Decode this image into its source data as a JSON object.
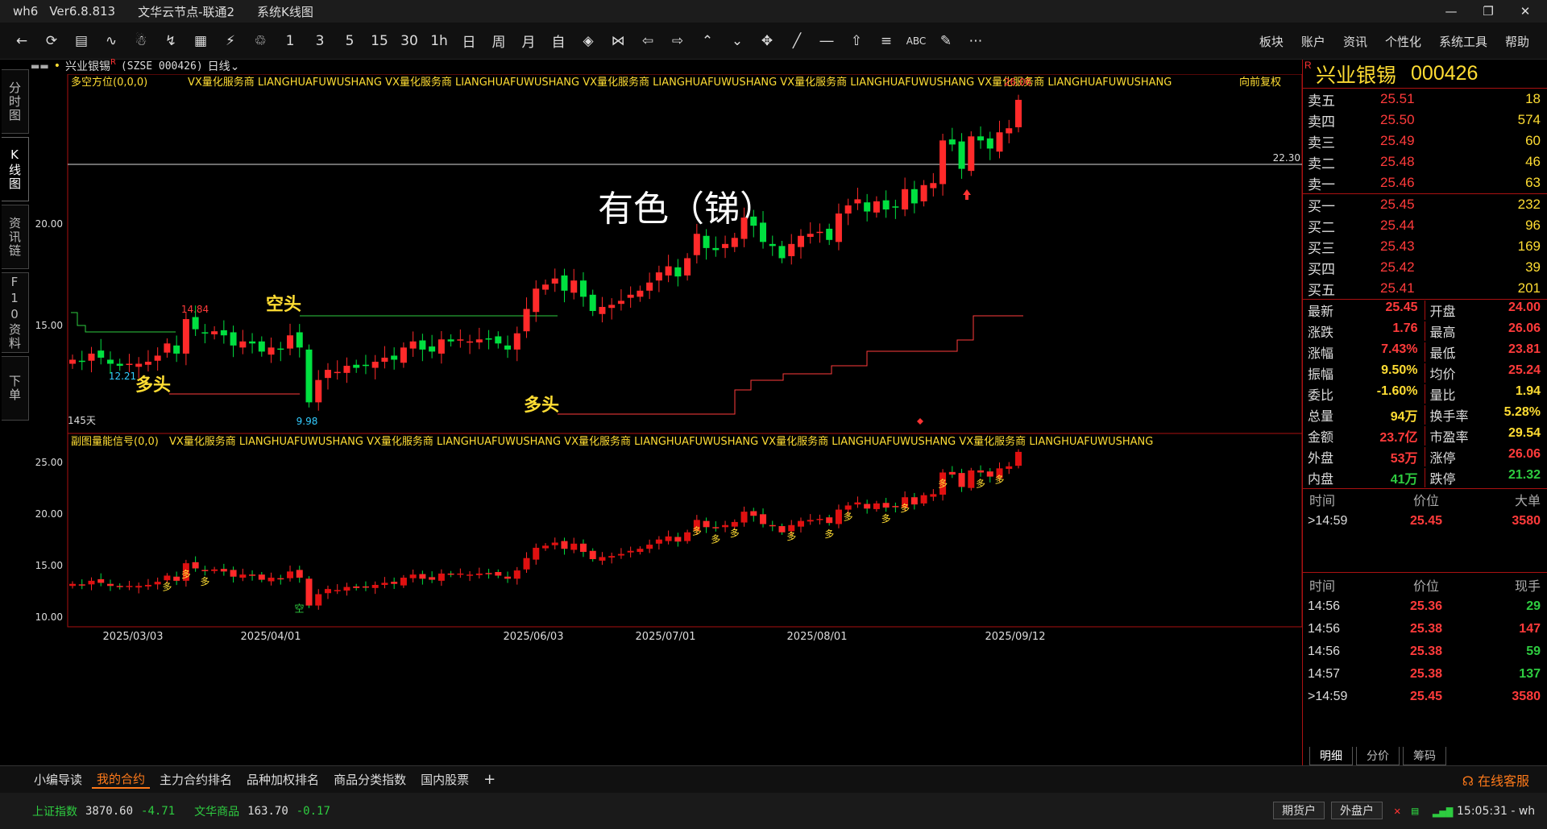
{
  "titlebar": {
    "app": "wh6",
    "version": "Ver6.8.813",
    "node": "文华云节点-联通2",
    "view": "系统K线图"
  },
  "toolbar": {
    "period_labels": [
      "1",
      "3",
      "5",
      "15",
      "30",
      "1h",
      "日",
      "周",
      "月",
      "自"
    ],
    "abc_label": "ABC",
    "menu": [
      "板块",
      "账户",
      "资讯",
      "个性化",
      "系统工具",
      "帮助"
    ]
  },
  "lefttabs": [
    "分时图",
    "K线图",
    "资讯链",
    "F10资料",
    "下单"
  ],
  "chartinfo": {
    "name": "兴业银锡",
    "sup": "R",
    "code": "(SZSE 000426)",
    "period": "日线"
  },
  "main_chart": {
    "indicator": "多空方位(0,0,0)",
    "ads": "VX量化服务商  LIANGHUAFUWUSHANG  VX量化服务商  LIANGHUAFUWUSHANG  VX量化服务商  LIANGHUAFUWUSHANG  VX量化服务商  LIANGHUAFUWUSHANG  VX量化服务商  LIANGHUAFUWUSHANG",
    "fq_label": "向前复权",
    "yticks": [
      "20.00",
      "15.00"
    ],
    "hline_label": "22.30",
    "high_label": "26.06",
    "label_1484": "14.84",
    "label_1221": "12.21",
    "label_998": "9.98",
    "days_label": "145天",
    "big_text": "有色（锑）",
    "kong_tou": "空头",
    "duo_tou_1": "多头",
    "duo_tou_2": "多头"
  },
  "sub_chart": {
    "indicator": "副图量能信号(0,0)",
    "ads": "VX量化服务商  LIANGHUAFUWUSHANG  VX量化服务商  LIANGHUAFUWUSHANG  VX量化服务商  LIANGHUAFUWUSHANG  VX量化服务商  LIANGHUAFUWUSHANG  VX量化服务商  LIANGHUAFUWUSHANG",
    "yticks": [
      "25.00",
      "20.00",
      "15.00",
      "10.00"
    ],
    "signal_duo": "多",
    "signal_kong": "空"
  },
  "xaxis": [
    "2025/03/03",
    "2025/04/01",
    "2025/06/03",
    "2025/07/01",
    "2025/08/01",
    "2025/09/12"
  ],
  "quote": {
    "name": "兴业银锡",
    "code": "000426",
    "mark": "R",
    "asks": [
      {
        "label": "卖五",
        "price": "25.51",
        "vol": "18"
      },
      {
        "label": "卖四",
        "price": "25.50",
        "vol": "574"
      },
      {
        "label": "卖三",
        "price": "25.49",
        "vol": "60"
      },
      {
        "label": "卖二",
        "price": "25.48",
        "vol": "46"
      },
      {
        "label": "卖一",
        "price": "25.46",
        "vol": "63"
      }
    ],
    "bids": [
      {
        "label": "买一",
        "price": "25.45",
        "vol": "232"
      },
      {
        "label": "买二",
        "price": "25.44",
        "vol": "96"
      },
      {
        "label": "买三",
        "price": "25.43",
        "vol": "169"
      },
      {
        "label": "买四",
        "price": "25.42",
        "vol": "39"
      },
      {
        "label": "买五",
        "price": "25.41",
        "vol": "201"
      }
    ],
    "stats": [
      [
        {
          "k": "最新",
          "v": "25.45",
          "c": "#ff3b3b"
        },
        {
          "k": "开盘",
          "v": "24.00",
          "c": "#ff3b3b"
        }
      ],
      [
        {
          "k": "涨跌",
          "v": "1.76",
          "c": "#ff3b3b"
        },
        {
          "k": "最高",
          "v": "26.06",
          "c": "#ff3b3b"
        }
      ],
      [
        {
          "k": "涨幅",
          "v": "7.43%",
          "c": "#ff3b3b"
        },
        {
          "k": "最低",
          "v": "23.81",
          "c": "#ff3b3b"
        }
      ],
      [
        {
          "k": "振幅",
          "v": "9.50%",
          "c": "#ffdd33"
        },
        {
          "k": "均价",
          "v": "25.24",
          "c": "#ff3b3b"
        }
      ],
      [
        {
          "k": "委比",
          "v": "-1.60%",
          "c": "#ffdd33"
        },
        {
          "k": "量比",
          "v": "1.94",
          "c": "#ffdd33"
        }
      ],
      [
        {
          "k": "总量",
          "v": "94万",
          "c": "#ffdd33"
        },
        {
          "k": "换手率",
          "v": "5.28%",
          "c": "#ffdd33"
        }
      ],
      [
        {
          "k": "金额",
          "v": "23.7亿",
          "c": "#ff3b3b"
        },
        {
          "k": "市盈率",
          "v": "29.54",
          "c": "#ffdd33"
        }
      ],
      [
        {
          "k": "外盘",
          "v": "53万",
          "c": "#ff3b3b"
        },
        {
          "k": "涨停",
          "v": "26.06",
          "c": "#ff3b3b"
        }
      ],
      [
        {
          "k": "内盘",
          "v": "41万",
          "c": "#2ecc40"
        },
        {
          "k": "跌停",
          "v": "21.32",
          "c": "#2ecc40"
        }
      ]
    ],
    "big_head": [
      "时间",
      "价位",
      "大单"
    ],
    "big_rows": [
      {
        "t": "14:59",
        "p": "25.45",
        "v": "3580",
        "c": "#ff3b3b"
      }
    ],
    "tick_head": [
      "时间",
      "价位",
      "现手"
    ],
    "tick_rows": [
      {
        "t": "14:56",
        "p": "25.36",
        "v": "29",
        "c": "#2ecc40"
      },
      {
        "t": "14:56",
        "p": "25.38",
        "v": "147",
        "c": "#ff3b3b"
      },
      {
        "t": "14:56",
        "p": "25.38",
        "v": "59",
        "c": "#2ecc40"
      },
      {
        "t": "14:57",
        "p": "25.38",
        "v": "137",
        "c": "#2ecc40"
      },
      {
        "t": "14:59",
        "p": "25.45",
        "v": "3580",
        "c": "#ff3b3b"
      }
    ],
    "tabs": [
      "明细",
      "分价",
      "筹码"
    ]
  },
  "bottomtabs": {
    "items": [
      "小编导读",
      "我的合约",
      "主力合约排名",
      "品种加权排名",
      "商品分类指数",
      "国内股票"
    ],
    "active": 1,
    "plus": "+",
    "service": "在线客服"
  },
  "statusbar": {
    "idx1_name": "上证指数",
    "idx1_val": "3870.60",
    "idx1_chg": "-4.71",
    "idx2_name": "文华商品",
    "idx2_val": "163.70",
    "idx2_chg": "-0.17",
    "btn1": "期货户",
    "btn2": "外盘户",
    "time": "15:05:31 - wh"
  },
  "chart_data": {
    "type": "candlestick",
    "note_price_range_main": [
      9.5,
      27.0
    ],
    "series_close": [
      12.6,
      12.5,
      12.9,
      12.7,
      12.4,
      12.3,
      12.4,
      12.4,
      12.5,
      12.8,
      13.4,
      12.9,
      14.6,
      14.1,
      13.9,
      14.0,
      13.8,
      13.3,
      13.5,
      13.4,
      13.0,
      13.2,
      13.1,
      13.8,
      13.2,
      10.5,
      11.6,
      12.1,
      12.0,
      12.3,
      12.2,
      12.3,
      12.5,
      12.7,
      12.6,
      13.2,
      13.5,
      13.1,
      13.0,
      13.6,
      13.5,
      13.6,
      13.5,
      13.6,
      13.6,
      13.4,
      13.1,
      13.9,
      15.1,
      16.1,
      16.3,
      16.6,
      16.0,
      16.5,
      15.7,
      15.0,
      15.2,
      15.3,
      15.5,
      15.8,
      16.0,
      16.4,
      16.9,
      17.2,
      16.7,
      17.6,
      18.8,
      18.1,
      18.0,
      18.3,
      18.6,
      19.6,
      19.2,
      18.4,
      18.2,
      17.6,
      18.3,
      18.7,
      18.8,
      18.9,
      18.5,
      19.8,
      20.2,
      20.5,
      19.9,
      20.4,
      20.0,
      20.1,
      21.0,
      20.3,
      21.2,
      21.3,
      23.4,
      23.2,
      22.0,
      23.6,
      23.4,
      23.0,
      23.8,
      24.0,
      25.4
    ],
    "pivot_labels": {
      "high": "26.06",
      "low": "9.98",
      "local_high": "14.84",
      "local_low": "12.21"
    },
    "hline": 22.3
  }
}
